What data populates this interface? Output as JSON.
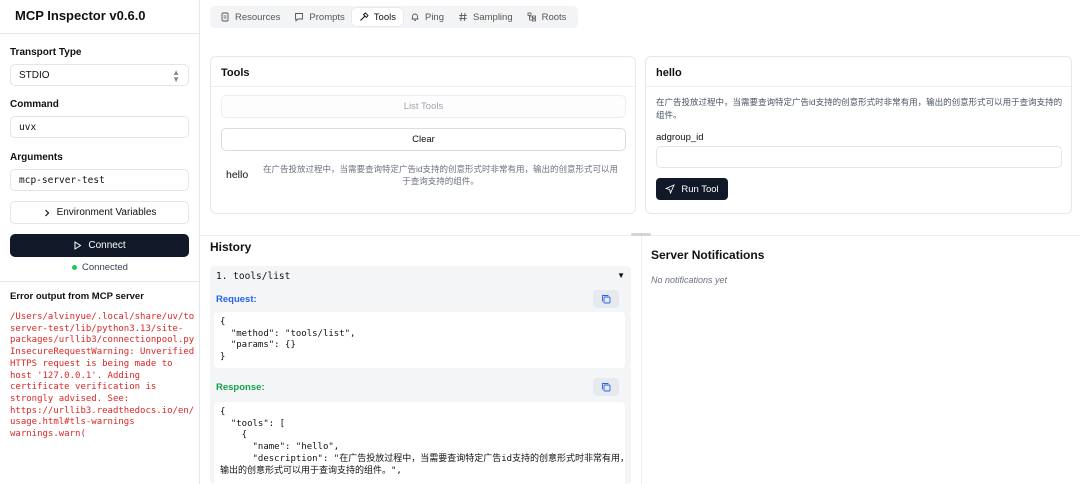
{
  "app": {
    "title": "MCP Inspector v0.6.0"
  },
  "sidebar": {
    "transport_label": "Transport Type",
    "transport_value": "STDIO",
    "command_label": "Command",
    "command_value": "uvx",
    "arguments_label": "Arguments",
    "arguments_value": "mcp-server-test",
    "env_button": "Environment Variables",
    "connect_button": "Connect",
    "status": "Connected",
    "error_title": "Error output from MCP server",
    "error_text": "/Users/alvinyue/.local/share/uv/to\nserver-test/lib/python3.13/site-\npackages/urllib3/connectionpool.py\nInsecureRequestWarning: Unverified\nHTTPS request is being made to\nhost '127.0.0.1'. Adding\ncertificate verification is\nstrongly advised. See:\nhttps://urllib3.readthedocs.io/en/\nusage.html#tls-warnings\nwarnings.warn("
  },
  "tabs": [
    {
      "label": "Resources",
      "icon": "file-icon"
    },
    {
      "label": "Prompts",
      "icon": "message-icon"
    },
    {
      "label": "Tools",
      "icon": "hammer-icon",
      "active": true
    },
    {
      "label": "Ping",
      "icon": "bell-icon"
    },
    {
      "label": "Sampling",
      "icon": "hash-icon"
    },
    {
      "label": "Roots",
      "icon": "folder-tree-icon"
    }
  ],
  "tools_panel": {
    "title": "Tools",
    "list_button": "List Tools",
    "clear_button": "Clear",
    "items": [
      {
        "name": "hello",
        "description": "在广告投放过程中，当需要查询特定广告id支持的创意形式时非常有用，输出的创意形式可以用于查询支持的组件。"
      }
    ]
  },
  "tool_detail": {
    "title": "hello",
    "description": "在广告投放过程中，当需要查询特定广告id支持的创意形式时非常有用，输出的创意形式可以用于查询支持的组件。",
    "param_label": "adgroup_id",
    "param_value": "",
    "run_button": "Run Tool"
  },
  "history": {
    "title": "History",
    "entry": "1. tools/list",
    "toggle": "▼",
    "request_label": "Request:",
    "request_code": "{\n  \"method\": \"tools/list\",\n  \"params\": {}\n}",
    "response_label": "Response:",
    "response_code": "{\n  \"tools\": [\n    {\n      \"name\": \"hello\",\n      \"description\": \"在广告投放过程中，当需要查询特定广告id支持的创意形式时非常有用，\n输出的创意形式可以用于查询支持的组件。\",",
    "request_color": "#2563eb",
    "response_color": "#16a34a"
  },
  "notifications": {
    "title": "Server Notifications",
    "empty": "No notifications yet"
  },
  "colors": {
    "error": "#dc2626",
    "primary_dark": "#111827",
    "status_ok": "#22c55e"
  }
}
